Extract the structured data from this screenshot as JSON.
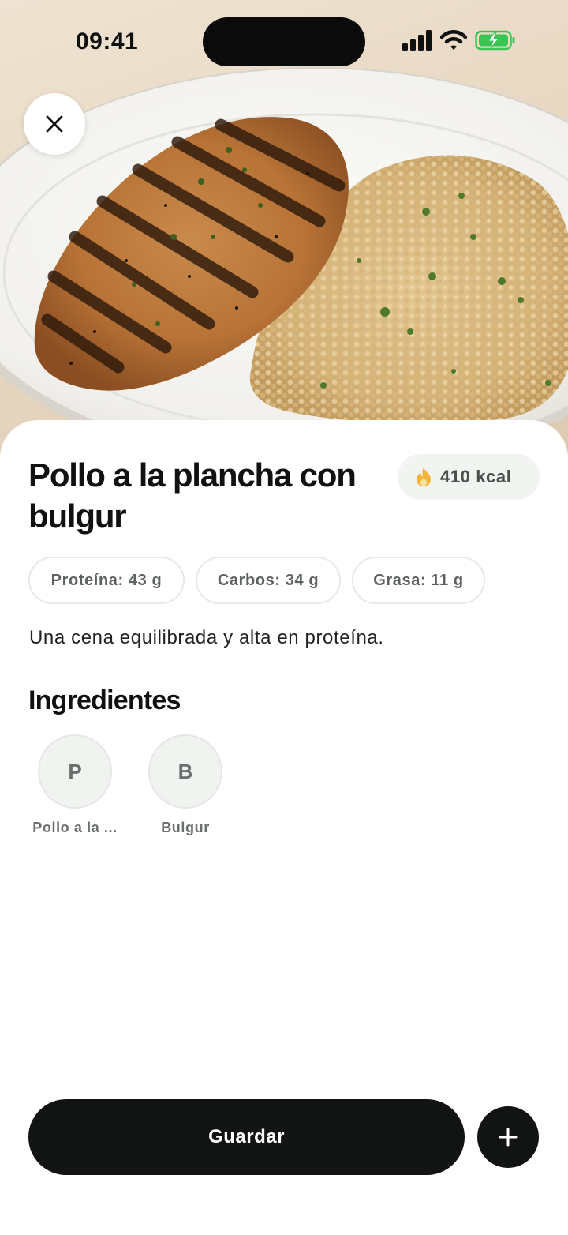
{
  "status_bar": {
    "time": "09:41",
    "icons": [
      "cellular-signal-icon",
      "wifi-icon",
      "battery-charging-icon"
    ],
    "battery_color": "#3cc452"
  },
  "hero": {
    "image": "grilled-chicken-with-bulgur-photo"
  },
  "close_button": {
    "icon": "close-icon"
  },
  "dish": {
    "title": "Pollo a la plancha con bulgur",
    "calories": {
      "label": "410 kcal",
      "icon": "flame-icon",
      "icon_color": "#f2b53a"
    },
    "macros": [
      {
        "label": "Proteína: 43 g"
      },
      {
        "label": "Carbos: 34 g"
      },
      {
        "label": "Grasa: 11 g"
      }
    ],
    "description": "Una cena equilibrada y alta en proteína."
  },
  "ingredients": {
    "title": "Ingredientes",
    "items": [
      {
        "initial": "P",
        "label": "Pollo a la ..."
      },
      {
        "initial": "B",
        "label": "Bulgur"
      }
    ]
  },
  "actions": {
    "save_label": "Guardar",
    "add_icon": "plus-icon"
  },
  "colors": {
    "primary_dark": "#121414",
    "chip_border": "#e7e9e7",
    "badge_bg": "#f2f4f2"
  }
}
